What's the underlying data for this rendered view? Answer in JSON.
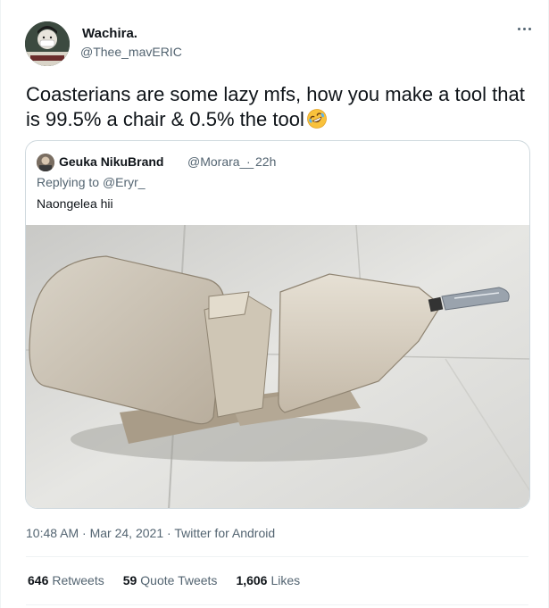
{
  "author": {
    "name": "Wachira.",
    "handle": "@Thee_mavERIC"
  },
  "tweet_text": "Coasterians are some lazy mfs, how you make a tool that is 99.5% a chair & 0.5% the tool",
  "emoji": "rolling-on-floor-laughing-emoji",
  "quoted": {
    "name": "Geuka NikuBrand",
    "handle": "@Morara__",
    "dot": "·",
    "time": "22h",
    "replying_prefix": "Replying to",
    "replying_to": "@Eryr_",
    "text": "Naongelea hii"
  },
  "meta": {
    "time": "10:48 AM",
    "sep1": "·",
    "date": "Mar 24, 2021",
    "sep2": "·",
    "source": "Twitter for Android"
  },
  "stats": [
    {
      "count": "646",
      "label": "Retweets"
    },
    {
      "count": "59",
      "label": "Quote Tweets"
    },
    {
      "count": "1,606",
      "label": "Likes"
    }
  ],
  "colors": {
    "text": "#0f1419",
    "secondary": "#536471",
    "border": "#cfd9de"
  }
}
